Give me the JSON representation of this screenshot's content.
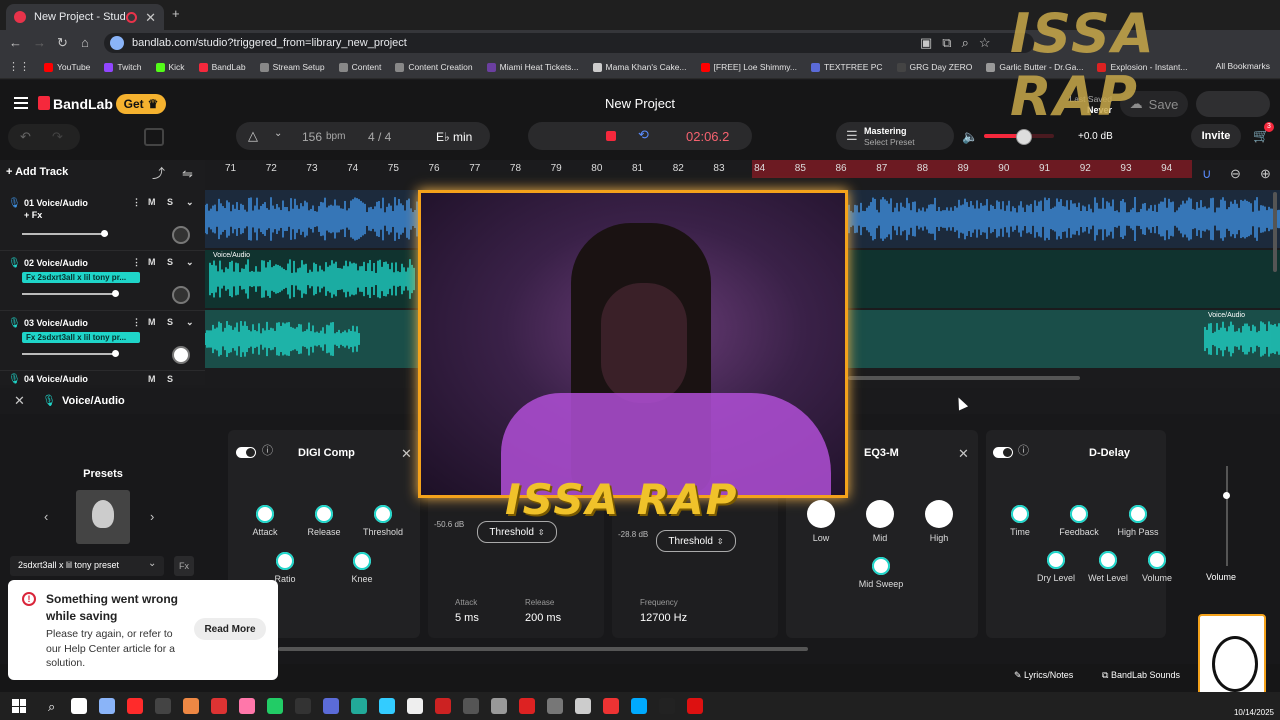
{
  "browser": {
    "tab_title": "New Project - Studio",
    "url": "bandlab.com/studio?triggered_from=library_new_project",
    "bookmarks": [
      {
        "label": "YouTube",
        "color": "#ff0000"
      },
      {
        "label": "Twitch",
        "color": "#9146ff"
      },
      {
        "label": "Kick",
        "color": "#53fc18"
      },
      {
        "label": "BandLab",
        "color": "#f5283c"
      },
      {
        "label": "Stream Setup",
        "color": "#888888"
      },
      {
        "label": "Content",
        "color": "#888888"
      },
      {
        "label": "Content Creation",
        "color": "#888888"
      },
      {
        "label": "Miami Heat Tickets...",
        "color": "#6b3fa0"
      },
      {
        "label": "Mama Khan's Cake...",
        "color": "#cccccc"
      },
      {
        "label": "[FREE] Loe Shimmy...",
        "color": "#ff0000"
      },
      {
        "label": "TEXTFREE PC",
        "color": "#5b6bd8"
      },
      {
        "label": "GRG Day ZERO",
        "color": "#444444"
      },
      {
        "label": "Garlic Butter - Dr.Ga...",
        "color": "#999999"
      },
      {
        "label": "Explosion - Instant...",
        "color": "#d22"
      }
    ],
    "all_bookmarks": "All Bookmarks"
  },
  "app": {
    "brand": "BandLab",
    "get_label": "Get",
    "project_title": "New Project",
    "last_saved_label": "Last Saved",
    "last_saved_value": "Never",
    "save_label": "Save",
    "invite_label": "Invite",
    "cart_badge": "3"
  },
  "transport": {
    "bpm_value": "156",
    "bpm_unit": "bpm",
    "time_signature": "4 / 4",
    "key": "E♭ min",
    "time": "02:06.2",
    "mastering_label": "Mastering",
    "select_preset": "Select Preset",
    "volume_db": "+0.0 dB",
    "volume_level": 0.55
  },
  "toolbar": {
    "add_track": "Add Track"
  },
  "ruler": [
    "71",
    "72",
    "73",
    "74",
    "75",
    "76",
    "77",
    "78",
    "79",
    "80",
    "81",
    "82",
    "83",
    "84",
    "85",
    "86",
    "87",
    "88",
    "89",
    "90",
    "91",
    "92",
    "93",
    "94"
  ],
  "tracks": [
    {
      "num": "01",
      "name": "Voice/Audio",
      "fx": "+ Fx",
      "color": "#3e8fe0"
    },
    {
      "num": "02",
      "name": "Voice/Audio",
      "fx": "Fx 2sdxrt3all x lil tony pr...",
      "color": "#1fd5c9",
      "clip_label": "Voice/Audio"
    },
    {
      "num": "03",
      "name": "Voice/Audio",
      "fx": "Fx 2sdxrt3all x lil tony pr...",
      "color": "#1fd5c9",
      "clip_label": "Voice/Audio"
    },
    {
      "num": "04",
      "name": "Voice/Audio"
    }
  ],
  "track_buttons": {
    "mute": "M",
    "solo": "S"
  },
  "fx_panel": {
    "track_name": "Voice/Audio",
    "presets_label": "Presets",
    "preset_name": "2sdxrt3all x lil tony preset",
    "digi_comp": {
      "title": "DIGI Comp",
      "knobs": [
        "Attack",
        "Release",
        "Threshold",
        "Ratio",
        "Knee"
      ]
    },
    "threshold_1": {
      "db": "-50.6 dB",
      "label": "Threshold",
      "attack_label": "Attack",
      "attack_value": "5 ms",
      "release_label": "Release",
      "release_value": "200 ms"
    },
    "threshold_2": {
      "db": "-28.8 dB",
      "label": "Threshold",
      "freq_label": "Frequency",
      "freq_value": "12700 Hz"
    },
    "eq3": {
      "title": "EQ3-M",
      "knobs": [
        "Low",
        "Mid",
        "High",
        "Mid Sweep"
      ]
    },
    "delay": {
      "title": "D-Delay",
      "knobs": [
        "Time",
        "Feedback",
        "High Pass",
        "Dry Level",
        "Wet Level",
        "Volume"
      ]
    },
    "volume_label": "Volume"
  },
  "footer": {
    "lyrics": "Lyrics/Notes",
    "sounds": "BandLab Sounds"
  },
  "toast": {
    "title": "Something went wrong while saving",
    "body": "Please try again, or refer to our Help Center article for a solution.",
    "action": "Read More"
  },
  "overlay": {
    "watermark": "ISSA RAP"
  },
  "taskbar": {
    "date": "10/14/2025"
  }
}
